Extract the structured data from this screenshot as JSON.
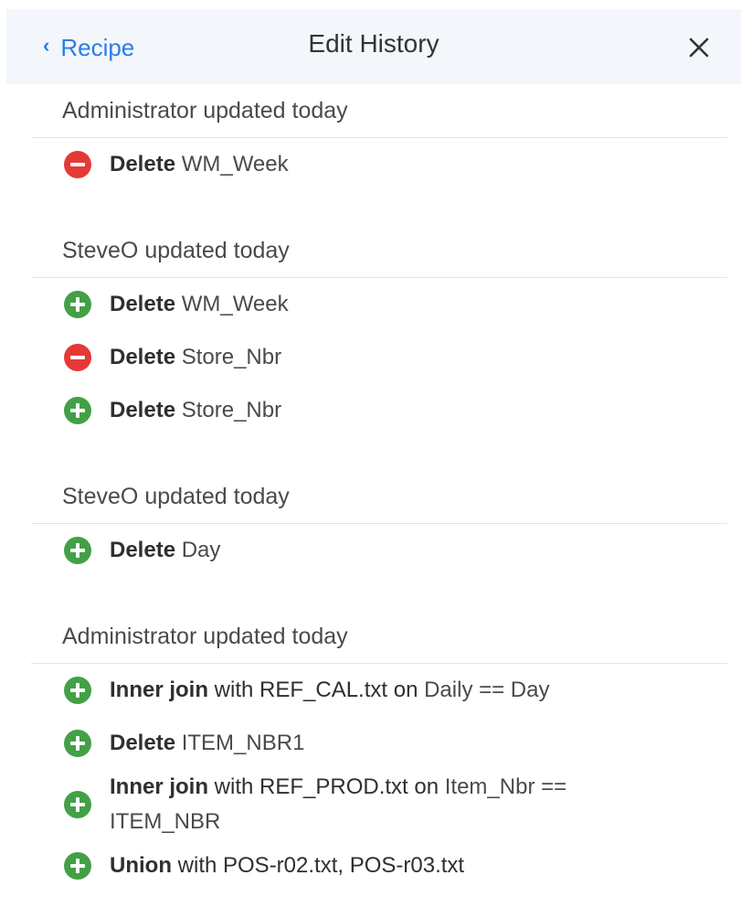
{
  "header": {
    "back_label": "Recipe",
    "title": "Edit History"
  },
  "colors": {
    "accent": "#2b7de9",
    "add": "#43a047",
    "remove": "#e53935"
  },
  "groups": [
    {
      "header": "Administrator updated today",
      "entries": [
        {
          "icon": "remove-circle-icon",
          "op": "Delete",
          "rest": "WM_Week"
        }
      ]
    },
    {
      "header": "SteveO updated today",
      "entries": [
        {
          "icon": "add-circle-icon",
          "op": "Delete",
          "rest": "WM_Week"
        },
        {
          "icon": "remove-circle-icon",
          "op": "Delete",
          "rest": "Store_Nbr"
        },
        {
          "icon": "add-circle-icon",
          "op": "Delete",
          "rest": "Store_Nbr"
        }
      ]
    },
    {
      "header": "SteveO updated today",
      "entries": [
        {
          "icon": "add-circle-icon",
          "op": "Delete",
          "rest": "Day"
        }
      ]
    },
    {
      "header": "Administrator updated today",
      "entries": [
        {
          "icon": "add-circle-icon",
          "op": "Inner join",
          "mid": "with REF_CAL.txt on",
          "rest": "Daily == Day"
        },
        {
          "icon": "add-circle-icon",
          "op": "Delete",
          "rest": "ITEM_NBR1"
        },
        {
          "icon": "add-circle-icon",
          "op": "Inner join",
          "mid": "with REF_PROD.txt on",
          "rest": "Item_Nbr == ITEM_NBR"
        },
        {
          "icon": "add-circle-icon",
          "op": "Union",
          "mid": "with POS-r02.txt, POS-r03.txt",
          "rest": ""
        }
      ]
    }
  ]
}
